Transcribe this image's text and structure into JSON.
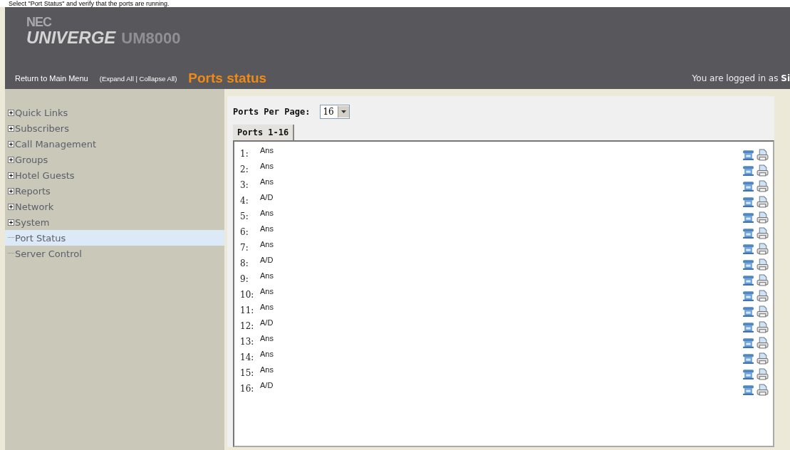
{
  "caption": "Select \"Port Status\" and verify that the ports are running.",
  "header": {
    "brand": "NEC",
    "product": "UNIVERGE",
    "model": "UM8000",
    "nav": [
      "Return to Main Menu",
      "(Expand All | Collapse All)"
    ],
    "page_title": "Ports status",
    "login": "You are logged in as **Si**"
  },
  "sidebar": {
    "items": [
      {
        "label": "Quick Links",
        "expandable": true,
        "selected": false
      },
      {
        "label": "Subscribers",
        "expandable": true,
        "selected": false
      },
      {
        "label": "Call Management",
        "expandable": true,
        "selected": false
      },
      {
        "label": "Groups",
        "expandable": true,
        "selected": false
      },
      {
        "label": "Hotel Guests",
        "expandable": true,
        "selected": false
      },
      {
        "label": "Reports",
        "expandable": true,
        "selected": false
      },
      {
        "label": "Network",
        "expandable": true,
        "selected": false
      },
      {
        "label": "System",
        "expandable": true,
        "selected": false
      },
      {
        "label": "Port Status",
        "expandable": false,
        "selected": true
      },
      {
        "label": "Server Control",
        "expandable": false,
        "selected": false
      }
    ]
  },
  "ports_per_page": {
    "label": "Ports Per Page:",
    "value": "16"
  },
  "tabs": [
    {
      "label": "Ports 1-16",
      "selected": true
    }
  ],
  "ports": [
    {
      "number": "1:",
      "status": "Ans"
    },
    {
      "number": "2:",
      "status": "Ans"
    },
    {
      "number": "3:",
      "status": "Ans"
    },
    {
      "number": "4:",
      "status": "A/D"
    },
    {
      "number": "5:",
      "status": "Ans"
    },
    {
      "number": "6:",
      "status": "Ans"
    },
    {
      "number": "7:",
      "status": "Ans"
    },
    {
      "number": "8:",
      "status": "A/D"
    },
    {
      "number": "9:",
      "status": "Ans"
    },
    {
      "number": "10:",
      "status": "Ans"
    },
    {
      "number": "11:",
      "status": "Ans"
    },
    {
      "number": "12:",
      "status": "A/D"
    },
    {
      "number": "13:",
      "status": "Ans"
    },
    {
      "number": "14:",
      "status": "Ans"
    },
    {
      "number": "15:",
      "status": "Ans"
    },
    {
      "number": "16:",
      "status": "A/D"
    }
  ]
}
